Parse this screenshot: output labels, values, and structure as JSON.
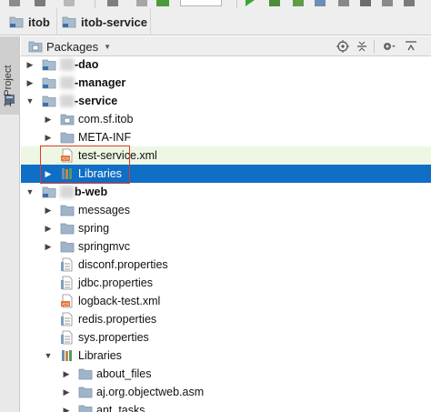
{
  "breadcrumb": {
    "items": [
      "itob",
      "itob-service"
    ]
  },
  "side_strip": {
    "project_tab_label": "1: Project"
  },
  "panel": {
    "view_label": "Packages"
  },
  "tree": [
    {
      "label": "-dao",
      "bold": true,
      "expanded": false,
      "icon": "module-folder-icon",
      "partially_obscured": true
    },
    {
      "label": "-manager",
      "bold": true,
      "expanded": false,
      "icon": "module-folder-icon",
      "partially_obscured": true
    },
    {
      "label": "-service",
      "bold": true,
      "expanded": true,
      "icon": "module-folder-icon",
      "partially_obscured": true
    },
    {
      "label": "com.sf.itob",
      "expanded": false,
      "icon": "package-icon"
    },
    {
      "label": "META-INF",
      "expanded": false,
      "icon": "folder-icon"
    },
    {
      "label": "test-service.xml",
      "icon": "xml-file-icon"
    },
    {
      "label": "Libraries",
      "expanded": false,
      "icon": "libraries-icon",
      "selected": true
    },
    {
      "label": "b-web",
      "bold": true,
      "expanded": true,
      "icon": "module-folder-icon",
      "partially_obscured": true
    },
    {
      "label": "messages",
      "expanded": false,
      "icon": "folder-icon"
    },
    {
      "label": "spring",
      "expanded": false,
      "icon": "folder-icon"
    },
    {
      "label": "springmvc",
      "expanded": false,
      "icon": "folder-icon"
    },
    {
      "label": "disconf.properties",
      "icon": "properties-file-icon"
    },
    {
      "label": "jdbc.properties",
      "icon": "properties-file-icon"
    },
    {
      "label": "logback-test.xml",
      "icon": "xml-file-icon"
    },
    {
      "label": "redis.properties",
      "icon": "properties-file-icon"
    },
    {
      "label": "sys.properties",
      "icon": "properties-file-icon"
    },
    {
      "label": "Libraries",
      "expanded": true,
      "icon": "libraries-icon"
    },
    {
      "label": "about_files",
      "expanded": false,
      "icon": "folder-icon"
    },
    {
      "label": "aj.org.objectweb.asm",
      "expanded": false,
      "icon": "folder-icon"
    },
    {
      "label": "ant_tasks",
      "expanded": false,
      "icon": "folder-icon"
    }
  ],
  "colors": {
    "selection": "#0f6ec5",
    "highlight_box": "#e03a2a",
    "folder": "#9fb4c8",
    "toolbar_bg": "#eeeeee"
  }
}
